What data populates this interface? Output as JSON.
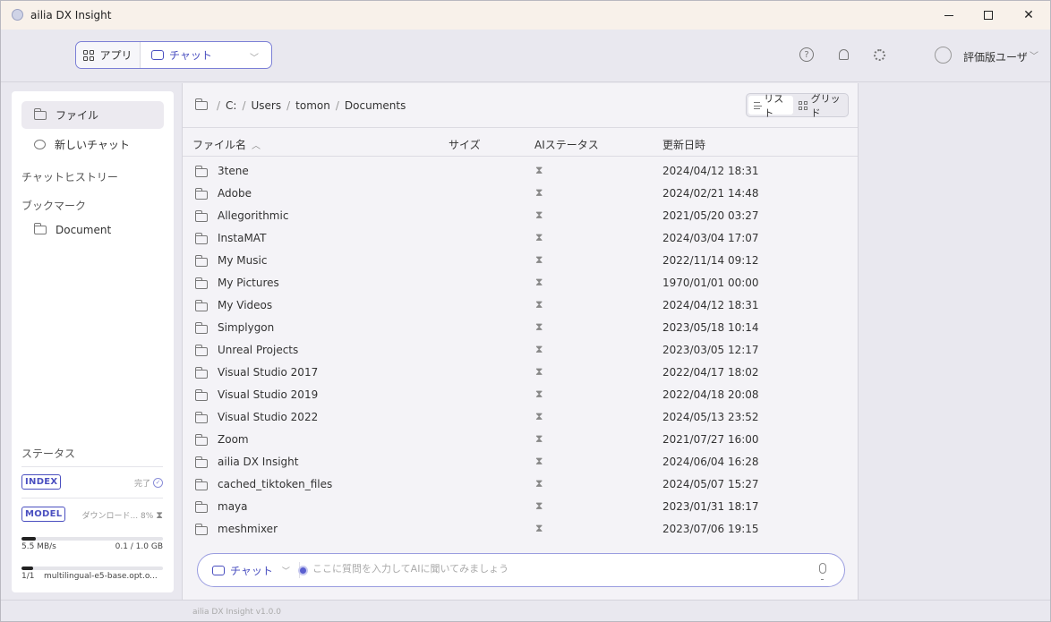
{
  "window": {
    "title": "ailia DX Insight",
    "min_icon": "minimize-icon",
    "max_icon": "maximize-icon",
    "close_icon": "close-icon"
  },
  "header": {
    "mode_app_label": "アプリ",
    "mode_chat_label": "チャット",
    "user_name": "評価版ユーザ"
  },
  "sidebar": {
    "file_label": "ファイル",
    "new_chat_label": "新しいチャット",
    "chat_history_label": "チャットヒストリー",
    "bookmarks_label": "ブックマーク",
    "bookmark_item": "Document",
    "status_title": "ステータス",
    "index_badge": "INDEX",
    "index_status": "完了",
    "model_badge": "MODEL",
    "model_status": "ダウンロード... 8%",
    "speed": "5.5 MB/s",
    "size": "0.1 / 1.0 GB",
    "download_progress": 0.1,
    "file_count": "1/1",
    "model_file": "multilingual-e5-base.opt.o...",
    "file_progress": 0.08
  },
  "breadcrumb": {
    "sep": "/",
    "parts": [
      "C:",
      "Users",
      "tomon",
      "Documents"
    ]
  },
  "view_toggle": {
    "list_label": "リスト",
    "grid_label": "グリッド"
  },
  "columns": {
    "name": "ファイル名",
    "size": "サイズ",
    "ai_status": "AIステータス",
    "modified": "更新日時"
  },
  "files": [
    {
      "name": "3tene",
      "date": "2024/04/12 18:31"
    },
    {
      "name": "Adobe",
      "date": "2024/02/21 14:48"
    },
    {
      "name": "Allegorithmic",
      "date": "2021/05/20 03:27"
    },
    {
      "name": "InstaMAT",
      "date": "2024/03/04 17:07"
    },
    {
      "name": "My Music",
      "date": "2022/11/14 09:12"
    },
    {
      "name": "My Pictures",
      "date": "1970/01/01 00:00"
    },
    {
      "name": "My Videos",
      "date": "2024/04/12 18:31"
    },
    {
      "name": "Simplygon",
      "date": "2023/05/18 10:14"
    },
    {
      "name": "Unreal Projects",
      "date": "2023/03/05 12:17"
    },
    {
      "name": "Visual Studio 2017",
      "date": "2022/04/17 18:02"
    },
    {
      "name": "Visual Studio 2019",
      "date": "2022/04/18 20:08"
    },
    {
      "name": "Visual Studio 2022",
      "date": "2024/05/13 23:52"
    },
    {
      "name": "Zoom",
      "date": "2021/07/27 16:00"
    },
    {
      "name": "ailia DX Insight",
      "date": "2024/06/04 16:28"
    },
    {
      "name": "cached_tiktoken_files",
      "date": "2024/05/07 15:27"
    },
    {
      "name": "maya",
      "date": "2023/01/31 18:17"
    },
    {
      "name": "meshmixer",
      "date": "2023/07/06 19:15"
    }
  ],
  "chat": {
    "mode_label": "チャット",
    "placeholder": "ここに質問を入力してAIに聞いてみましょう"
  },
  "version": "ailia DX Insight v1.0.0"
}
